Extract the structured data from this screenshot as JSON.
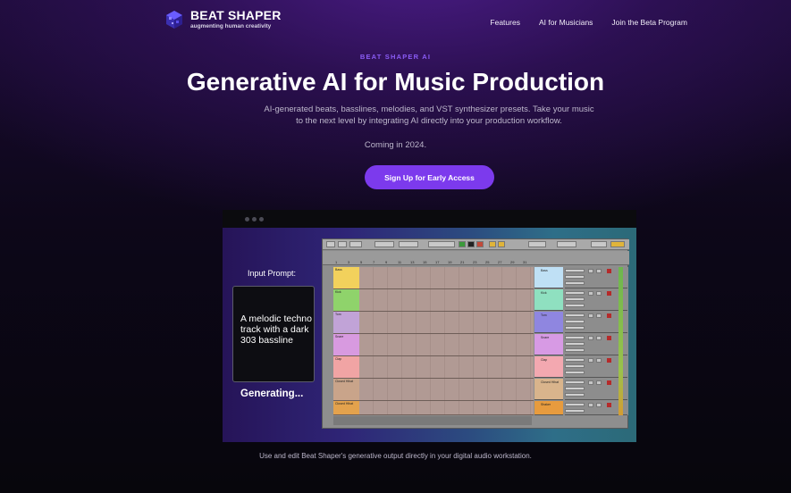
{
  "brand": {
    "name": "BEAT SHAPER",
    "tagline": "augmenting human creativity",
    "accent": "#7c3aed"
  },
  "nav": {
    "links": [
      "Features",
      "AI for Musicians",
      "Join the Beta Program"
    ]
  },
  "hero": {
    "eyebrow": "BEAT SHAPER AI",
    "title": "Generative AI for Music Production",
    "subtitle": "AI-generated beats, basslines, melodies, and VST synthesizer presets. Take your music to the next level by integrating AI directly into your production workflow.",
    "coming": "Coming in 2024.",
    "cta_label": "Sign Up for Early Access"
  },
  "demo": {
    "prompt_label": "Input Prompt:",
    "prompt_text": "A melodic techno track with a dark 303 bassline",
    "status": "Generating...",
    "tracks": [
      "Bass",
      "Kick",
      "Tom",
      "Snare",
      "Clap",
      "Closed Hihat",
      "Shaker"
    ],
    "clip_labels": [
      "Bass",
      "Kick",
      "Tom",
      "Snare",
      "Clap",
      "Closed Hihat",
      "Closed Hihat"
    ],
    "ruler_ticks": [
      "1",
      "3",
      "5",
      "7",
      "9",
      "11",
      "13",
      "15",
      "17",
      "19",
      "21",
      "23",
      "25",
      "27",
      "29",
      "31"
    ],
    "caption": "Use and edit Beat Shaper's generative output directly in your digital audio workstation."
  }
}
